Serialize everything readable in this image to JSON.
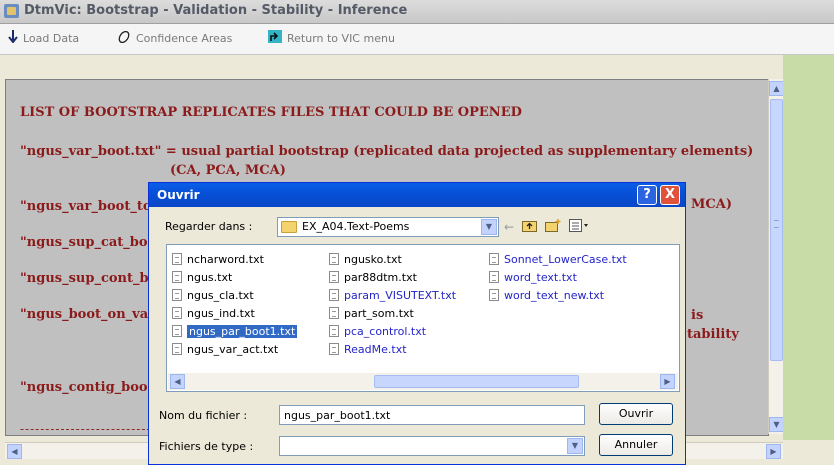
{
  "window": {
    "title": "DtmVic: Bootstrap - Validation - Stability - Inference"
  },
  "menu": {
    "load_data": "Load Data",
    "confidence_areas": "Confidence Areas",
    "return_vic": "Return to VIC menu"
  },
  "document": {
    "heading": "LIST  OF  BOOTSTRAP  REPLICATES  FILES  THAT  COULD  BE  OPENED",
    "line1": "\"ngus_var_boot.txt\"  =  usual partial bootstrap  (replicated data projected as supplementary  elements)",
    "line1b": "(CA, PCA, MCA)",
    "line2": "\"ngus_var_boot_to",
    "line2_right": "MCA)",
    "line3": "\"ngus_sup_cat_boo",
    "line4": "\"ngus_sup_cont_b",
    "line5": "\"ngus_boot_on_va",
    "line5_right": "is",
    "line5b_right": "tability",
    "line6": "\"ngus_contig_boot",
    "dashes": "----------------------------------------"
  },
  "dialog": {
    "title": "Ouvrir",
    "help": "?",
    "close": "X",
    "look_in_label": "Regarder dans :",
    "look_in_value": "EX_A04.Text-Poems",
    "file_name_label": "Nom du fichier :",
    "file_name_value": "ngus_par_boot1.txt",
    "file_type_label": "Fichiers de type :",
    "file_type_value": "",
    "open_button": "Ouvrir",
    "cancel_button": "Annuler",
    "files_col1": [
      "ncharword.txt",
      "ngus.txt",
      "ngus_cla.txt",
      "ngus_ind.txt",
      "ngus_par_boot1.txt",
      "ngus_var_act.txt"
    ],
    "files_col2": [
      "ngusko.txt",
      "par88dtm.txt",
      "param_VISUTEXT.txt",
      "part_som.txt",
      "pca_control.txt",
      "ReadMe.txt"
    ],
    "files_col3": [
      "Sonnet_LowerCase.txt",
      "word_text.txt",
      "word_text_new.txt"
    ],
    "selected_file": "ngus_par_boot1.txt"
  },
  "colors": {
    "doc_text": "#8b1a1a",
    "dialog_title": "#0751d8",
    "selection": "#316ac5"
  }
}
